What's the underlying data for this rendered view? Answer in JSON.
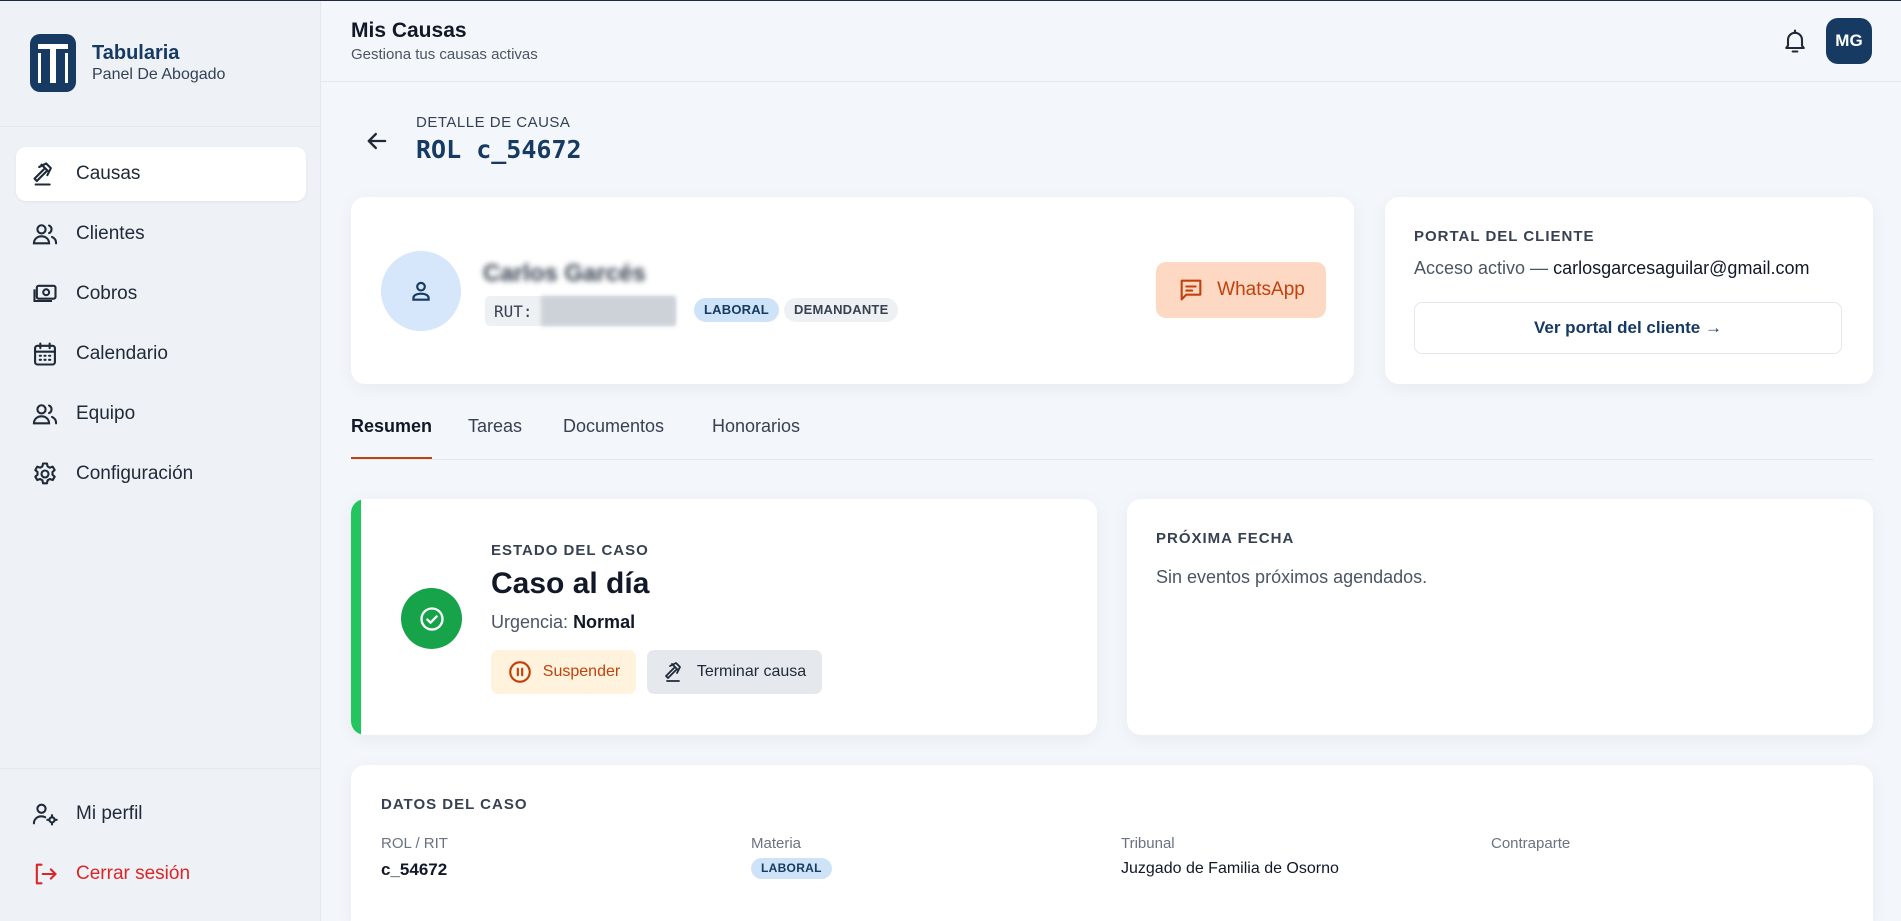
{
  "sidebar": {
    "brand_name": "Tabularia",
    "brand_sub": "Panel De Abogado",
    "items": [
      {
        "label": "Causas"
      },
      {
        "label": "Clientes"
      },
      {
        "label": "Cobros"
      },
      {
        "label": "Calendario"
      },
      {
        "label": "Equipo"
      },
      {
        "label": "Configuración"
      }
    ],
    "bottom_items": [
      {
        "label": "Mi perfil"
      },
      {
        "label": "Cerrar sesión"
      }
    ]
  },
  "header": {
    "title": "Mis Causas",
    "subtitle": "Gestiona tus causas activas",
    "user_initials": "MG"
  },
  "page": {
    "overline": "DETALLE DE CAUSA",
    "title": "ROL c_54672"
  },
  "client": {
    "name": "Carlos Garcés",
    "rut_label": "RUT:",
    "rut_value": "",
    "tags": [
      "LABORAL",
      "DEMANDANTE"
    ],
    "whatsapp_label": "WhatsApp"
  },
  "portal": {
    "title": "PORTAL DEL CLIENTE",
    "access_prefix": "Acceso activo —",
    "email": "carlosgarcesaguilar@gmail.com",
    "button_label": "Ver portal del cliente →"
  },
  "tabs": [
    {
      "label": "Resumen",
      "active": true
    },
    {
      "label": "Tareas"
    },
    {
      "label": "Documentos"
    },
    {
      "label": "Honorarios"
    }
  ],
  "status": {
    "label": "ESTADO DEL CASO",
    "title": "Caso al día",
    "urgency_label": "Urgencia:",
    "urgency_value": "Normal",
    "suspend_label": "Suspender",
    "terminate_label": "Terminar causa",
    "accent_color": "#22c55e"
  },
  "next_date": {
    "title": "PRÓXIMA FECHA",
    "text": "Sin eventos próximos agendados."
  },
  "case_data": {
    "title": "DATOS DEL CASO",
    "columns": [
      {
        "label": "ROL / RIT",
        "value": "c_54672"
      },
      {
        "label": "Materia",
        "value": "LABORAL"
      },
      {
        "label": "Tribunal",
        "value": "Juzgado de Familia de Osorno"
      },
      {
        "label": "Contraparte",
        "value": ""
      }
    ]
  },
  "colors": {
    "brand": "#173a63",
    "accent": "#c2410c",
    "danger": "#dc2626",
    "success": "#16a34a"
  }
}
